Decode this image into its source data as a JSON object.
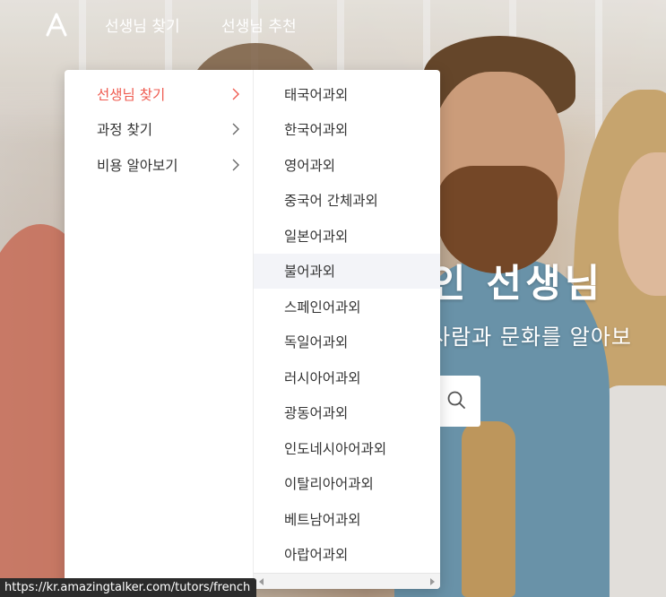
{
  "nav": {
    "logo_icon": "amazingtalker-logo-icon",
    "items": [
      {
        "label": "선생님 찾기"
      },
      {
        "label": "선생님 추천"
      }
    ]
  },
  "hero": {
    "title": "인 선생님",
    "subtitle": "사람과 문화를 알아보",
    "search_icon": "search-icon"
  },
  "dropdown": {
    "categories": [
      {
        "label": "선생님 찾기",
        "active": true
      },
      {
        "label": "과정 찾기",
        "active": false
      },
      {
        "label": "비용 알아보기",
        "active": false
      }
    ],
    "submenu": [
      {
        "label": "태국어과외"
      },
      {
        "label": "한국어과외"
      },
      {
        "label": "영어과외"
      },
      {
        "label": "중국어 간체과외"
      },
      {
        "label": "일본어과외"
      },
      {
        "label": "불어과외",
        "hovered": true
      },
      {
        "label": "스페인어과외"
      },
      {
        "label": "독일어과외"
      },
      {
        "label": "러시아어과외"
      },
      {
        "label": "광동어과외"
      },
      {
        "label": "인도네시아어과외"
      },
      {
        "label": "이탈리아어과외"
      },
      {
        "label": "베트남어과외"
      },
      {
        "label": "아랍어과외"
      }
    ]
  },
  "statusbar": {
    "url": "https://kr.amazingtalker.com/tutors/french"
  },
  "colors": {
    "accent": "#ef5b50",
    "text": "#333333",
    "hover_bg": "#f3f4f8"
  }
}
